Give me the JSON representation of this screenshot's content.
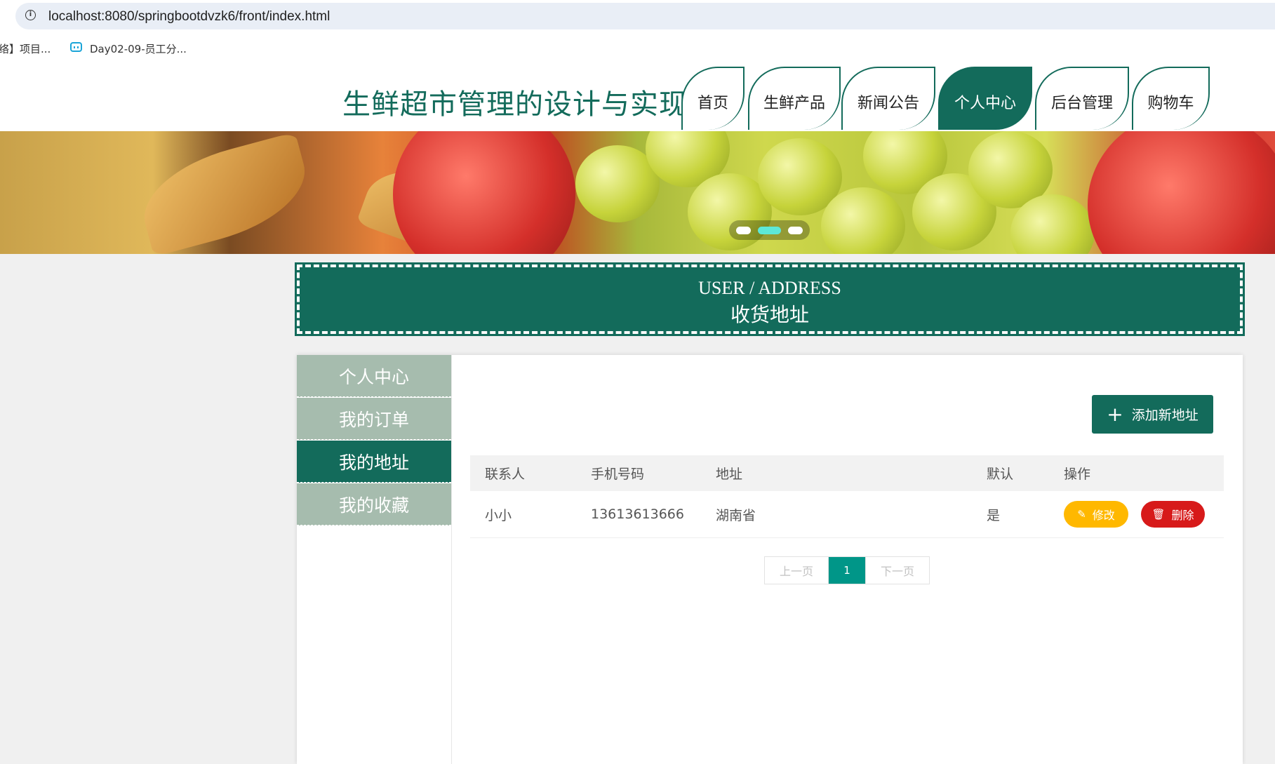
{
  "browser": {
    "url": "localhost:8080/springbootdvzk6/front/index.html",
    "bookmarks": [
      {
        "label": "络】项目..."
      },
      {
        "label": "Day02-09-员工分..."
      }
    ]
  },
  "site": {
    "title": "生鲜超市管理的设计与实现",
    "nav": [
      {
        "label": "首页",
        "active": false
      },
      {
        "label": "生鲜产品",
        "active": false
      },
      {
        "label": "新闻公告",
        "active": false
      },
      {
        "label": "个人中心",
        "active": true
      },
      {
        "label": "后台管理",
        "active": false
      },
      {
        "label": "购物车",
        "active": false
      }
    ],
    "accent_color": "#136b5b"
  },
  "banner": {
    "slide_count": 3,
    "active_slide": 2
  },
  "section": {
    "title_en": "USER / ADDRESS",
    "title_cn": "收货地址"
  },
  "sidebar": {
    "items": [
      {
        "label": "个人中心",
        "active": false
      },
      {
        "label": "我的订单",
        "active": false
      },
      {
        "label": "我的地址",
        "active": true
      },
      {
        "label": "我的收藏",
        "active": false
      }
    ]
  },
  "main": {
    "add_button": "添加新地址",
    "columns": [
      "联系人",
      "手机号码",
      "地址",
      "默认",
      "操作"
    ],
    "rows": [
      {
        "contact": "小小",
        "phone": "13613613666",
        "address": "湖南省",
        "default": "是"
      }
    ],
    "edit_label": "修改",
    "delete_label": "删除",
    "edit_color": "#ffb800",
    "delete_color": "#d71a1a"
  },
  "pagination": {
    "prev": "上一页",
    "current": "1",
    "next": "下一页"
  }
}
